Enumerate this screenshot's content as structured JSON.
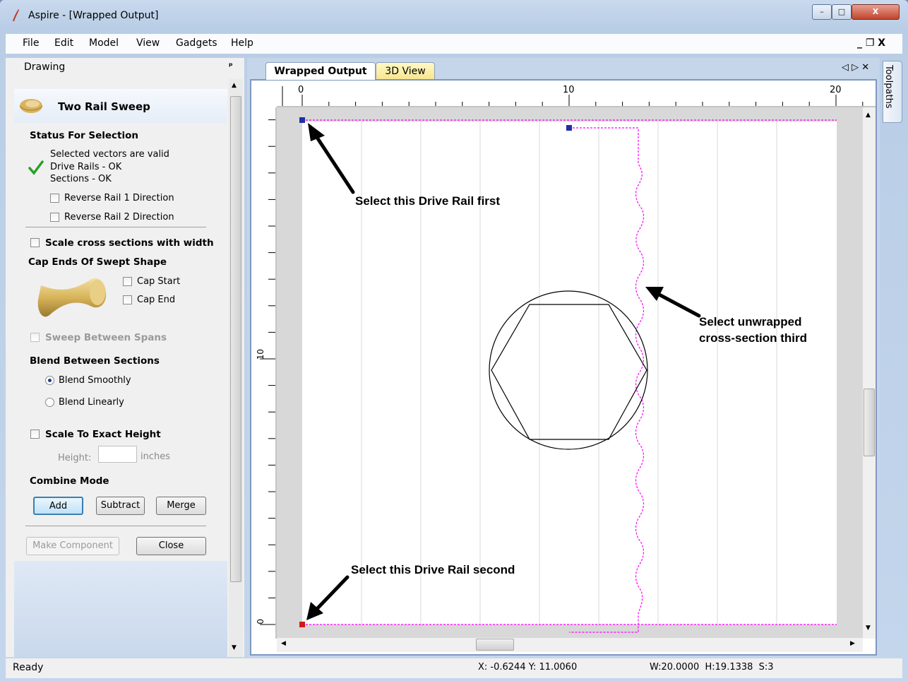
{
  "window": {
    "title": "Aspire - [Wrapped Output]",
    "controls": [
      "–",
      "□",
      "X"
    ]
  },
  "menu": {
    "items": [
      "File",
      "Edit",
      "Model",
      "View",
      "Gadgets",
      "Help"
    ],
    "mdi_controls": "_ ❐ X"
  },
  "panel": {
    "dock_title": "Drawing",
    "pin": "ᵖ",
    "header": "Two Rail Sweep",
    "status_heading": "Status For Selection",
    "status_lines": [
      "Selected vectors are valid",
      "Drive Rails - OK",
      "Sections - OK"
    ],
    "reverse1": "Reverse Rail 1 Direction",
    "reverse2": "Reverse Rail 2 Direction",
    "scale_cross": "Scale cross sections with width",
    "cap_heading": "Cap Ends Of Swept Shape",
    "cap_start": "Cap Start",
    "cap_end": "Cap End",
    "sweep_between": "Sweep Between Spans",
    "blend_heading": "Blend Between Sections",
    "blend_smooth": "Blend Smoothly",
    "blend_linear": "Blend Linearly",
    "scale_height": "Scale To Exact Height",
    "height_label": "Height:",
    "height_value": "",
    "height_unit": "inches",
    "combine_heading": "Combine Mode",
    "btn_add": "Add",
    "btn_subtract": "Subtract",
    "btn_merge": "Merge",
    "btn_make_component": "Make Component",
    "btn_close": "Close",
    "checks": {
      "reverse1": false,
      "reverse2": false,
      "scale_cross": false,
      "cap_start": false,
      "cap_end": false,
      "sweep_between": false,
      "scale_height": false
    },
    "blend_selected": "Blend Smoothly"
  },
  "tabs": [
    {
      "label": "Wrapped Output",
      "active": true
    },
    {
      "label": "3D View",
      "active": false
    }
  ],
  "doc_controls": "◁ ▷ ✕",
  "toolpaths_tab": "Toolpaths",
  "ruler": {
    "h_labels": [
      "0",
      "10",
      "20"
    ],
    "v_labels": [
      "10",
      "0"
    ]
  },
  "annotations": {
    "rail1": "Select this Drive Rail first",
    "cross_line1": "Select unwrapped",
    "cross_line2": "cross-section third",
    "rail2": "Select this Drive Rail second"
  },
  "status": {
    "left": "Ready",
    "coords": "X: -0.6244 Y: 11.0060",
    "dims": "W:20.0000  H:19.1338  S:3"
  },
  "colors": {
    "accent_frame": "#7f98c1",
    "rail_dash": "#ff00ff",
    "node_blue": "#1f2fa8",
    "node_red": "#d01818",
    "checkmark": "#2aa02a"
  },
  "icons": [
    "app-icon",
    "sweep-shape-icon",
    "checkmark-icon",
    "cap-shape-image"
  ]
}
